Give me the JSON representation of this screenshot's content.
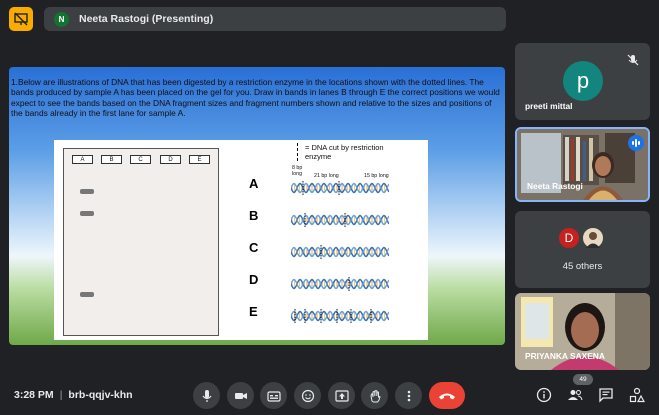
{
  "top_bar": {
    "presenter_initial": "N",
    "presenting_label": "Neeta Rastogi (Presenting)"
  },
  "slide": {
    "question": "1.Below are illustrations of DNA that has been digested by a restriction enzyme in the locations shown with the dotted lines. The bands produced by sample A has been placed on the gel for you. Draw in bands in lanes B through E the correct positions we would expect to see the bands based on the DNA fragment sizes and fragment numbers shown and relative to the sizes and positions of the bands already in the first lane for sample A.",
    "gel_lanes": [
      "A",
      "B",
      "C",
      "D",
      "E"
    ],
    "legend": "= DNA cut by restriction enzyme",
    "row_labels": [
      "A",
      "B",
      "C",
      "D",
      "E"
    ],
    "note_8bp": "8 bp long",
    "note_21bp": "21 bp long",
    "note_15bp": "15 bp long"
  },
  "participants": {
    "preeti": {
      "initial": "p",
      "name": "preeti mittal"
    },
    "neeta": {
      "name": "Neeta Rastogi"
    },
    "others": {
      "initial": "D",
      "count_label": "45 others"
    },
    "priyanka": {
      "name": "PRIYANKA SAXENA"
    }
  },
  "bottom_bar": {
    "time": "3:28 PM",
    "meeting_code": "brb-qqjv-khn",
    "people_count": "49"
  },
  "colors": {
    "accent": "#8ab4f8",
    "end_call": "#ea4335",
    "dna_blue": "#2f6fb3",
    "dna_orange": "#e8912d"
  }
}
